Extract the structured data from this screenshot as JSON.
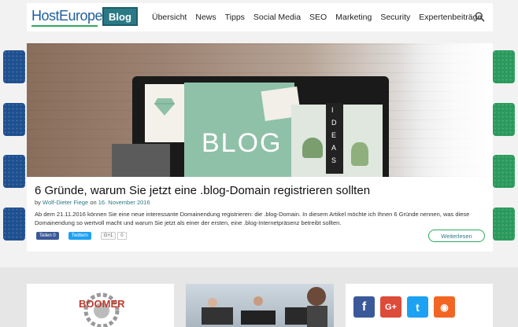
{
  "header": {
    "logo": "HostEurope",
    "blog_label": "Blog",
    "nav": [
      "Übersicht",
      "News",
      "Tipps",
      "Social Media",
      "SEO",
      "Marketing",
      "Security",
      "Expertenbeiträge"
    ]
  },
  "hero": {
    "image_text": "BLOG",
    "ideas_letters": [
      "I",
      "D",
      "E",
      "A",
      "S"
    ],
    "title": "6 Gründe, warum Sie jetzt eine .blog-Domain registrieren sollten",
    "by_prefix": "by",
    "author": "Wolf-Dieter Fiege",
    "on_word": "on",
    "date": "16. November 2016",
    "excerpt": "Ab dem 21.11.2016 können Sie eine neue interessante Domainendung registrieren: die .blog-Domain. In diesem Artikel möchte ich Ihnen 6 Gründe nennen, was diese Domainendung so wertvoll macht und warum Sie jetzt als einer der ersten, eine .blog-Internetpräsenz betreibt sollten.",
    "share_facebook": "Teilen 0",
    "share_twitter": "Twittern",
    "share_gplus": "G+1",
    "share_gplus_count": "0",
    "read_more": "Weiterlesen"
  },
  "colors": {
    "brand_blue": "#1f5f9e",
    "brand_green": "#2eaa5c",
    "blog_teal": "#2a7a86"
  },
  "social": {
    "facebook_glyph": "f",
    "gplus_glyph": "G+",
    "twitter_glyph": "t",
    "rss_glyph": "◉"
  }
}
